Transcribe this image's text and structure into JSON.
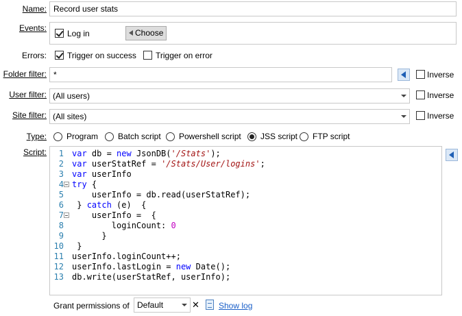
{
  "labels": {
    "name": "Name:",
    "events": "Events:",
    "errors": "Errors:",
    "folder_filter": "Folder filter:",
    "user_filter": "User filter:",
    "site_filter": "Site filter:",
    "type": "Type:",
    "script": "Script:"
  },
  "name_value": "Record user stats",
  "events": {
    "login_label": "Log in",
    "login_checked": true,
    "choose_label": "Choose"
  },
  "errors": {
    "success_label": "Trigger on success",
    "success_checked": true,
    "error_label": "Trigger on error",
    "error_checked": false
  },
  "folder_filter": {
    "value": "*",
    "inverse_label": "Inverse"
  },
  "user_filter": {
    "value": "(All users)",
    "inverse_label": "Inverse"
  },
  "site_filter": {
    "value": "(All sites)",
    "inverse_label": "Inverse"
  },
  "type_options": [
    {
      "label": "Program",
      "selected": false
    },
    {
      "label": "Batch script",
      "selected": false
    },
    {
      "label": "Powershell script",
      "selected": false
    },
    {
      "label": "JSS script",
      "selected": true
    },
    {
      "label": "FTP script",
      "selected": false
    }
  ],
  "script_lines": [
    {
      "num": "1",
      "fold": false,
      "tokens": [
        [
          "kw",
          "var"
        ],
        [
          "",
          "db = "
        ],
        [
          "kw",
          "new"
        ],
        [
          "",
          "JsonDB("
        ],
        [
          "str",
          "'/Stats'"
        ],
        [
          "",
          ");"
        ]
      ]
    },
    {
      "num": "2",
      "fold": false,
      "tokens": [
        [
          "kw",
          "var"
        ],
        [
          "",
          "userStatRef = "
        ],
        [
          "str",
          "'/Stats/User/logins'"
        ],
        [
          "",
          ";"
        ]
      ]
    },
    {
      "num": "3",
      "fold": false,
      "tokens": [
        [
          "kw",
          "var"
        ],
        [
          "",
          "userInfo"
        ]
      ]
    },
    {
      "num": "4",
      "fold": true,
      "tokens": [
        [
          "kw",
          "try"
        ],
        [
          "",
          " {"
        ]
      ]
    },
    {
      "num": "5",
      "fold": false,
      "tokens": [
        [
          "",
          "    userInfo = db.read(userStatRef);"
        ]
      ]
    },
    {
      "num": "6",
      "fold": false,
      "tokens": [
        [
          "",
          " } "
        ],
        [
          "kw",
          "catch"
        ],
        [
          "",
          " (e)  {"
        ]
      ]
    },
    {
      "num": "7",
      "fold": true,
      "tokens": [
        [
          "",
          "    userInfo =  {"
        ]
      ]
    },
    {
      "num": "8",
      "fold": false,
      "tokens": [
        [
          "",
          "        loginCount: "
        ],
        [
          "num",
          "0"
        ]
      ]
    },
    {
      "num": "9",
      "fold": false,
      "tokens": [
        [
          "",
          "      }"
        ]
      ]
    },
    {
      "num": "10",
      "fold": false,
      "tokens": [
        [
          "",
          " }"
        ]
      ]
    },
    {
      "num": "11",
      "fold": false,
      "tokens": [
        [
          "",
          "userInfo.loginCount++;"
        ]
      ]
    },
    {
      "num": "12",
      "fold": false,
      "tokens": [
        [
          "",
          "userInfo.lastLogin = "
        ],
        [
          "kw",
          "new"
        ],
        [
          "",
          " Date();"
        ]
      ]
    },
    {
      "num": "13",
      "fold": false,
      "tokens": [
        [
          "",
          "db.write(userStatRef, userInfo);"
        ]
      ]
    }
  ],
  "footer": {
    "grant_label": "Grant permissions of",
    "grant_value": "Default",
    "clear_symbol": "✕",
    "show_log_label": "Show log"
  },
  "colors": {
    "keyword": "#0000ff",
    "string": "#a31515",
    "number": "#c000c0",
    "line_number": "#2b7fae",
    "link": "#1a5fc8"
  }
}
